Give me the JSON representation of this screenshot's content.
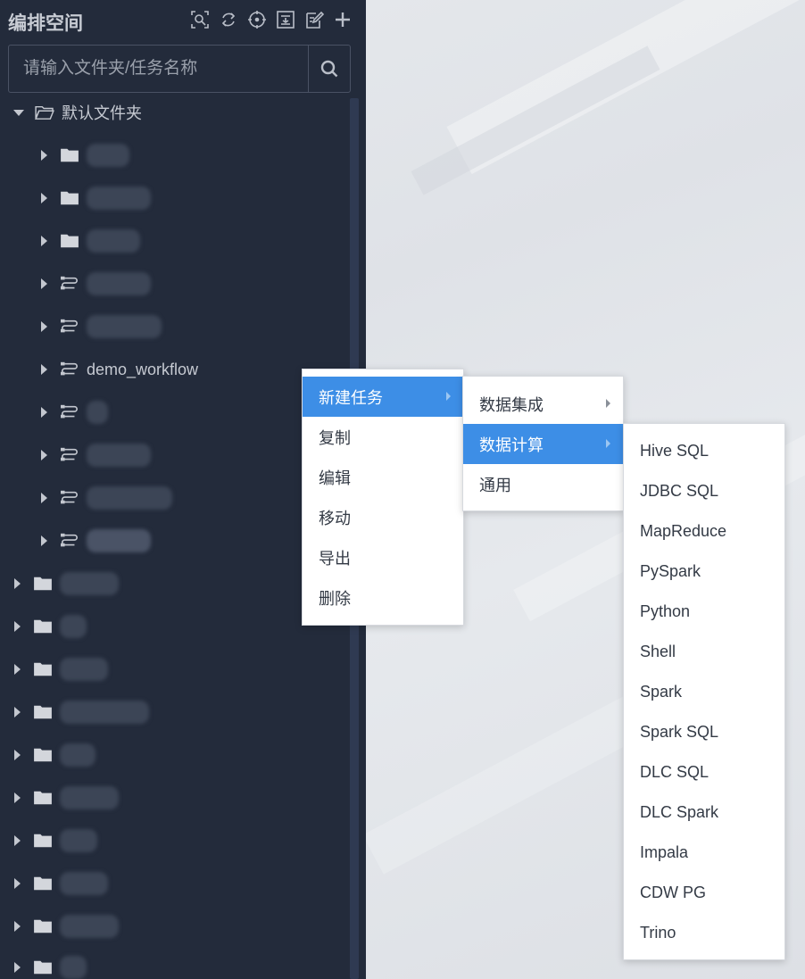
{
  "colors": {
    "sidebar_bg": "#232b3b",
    "accent": "#3d8ee6",
    "menu_bg": "#ffffff"
  },
  "sidebar": {
    "title": "编排空间",
    "toolbar_icons": [
      "locate-box-icon",
      "refresh-icon",
      "crosshair-icon",
      "import-icon",
      "edit-icon",
      "plus-icon"
    ],
    "search": {
      "placeholder": "请输入文件夹/任务名称",
      "value": ""
    },
    "tree": {
      "root_label": "默认文件夹",
      "children": [
        {
          "type": "folder",
          "label": ""
        },
        {
          "type": "folder",
          "label": ""
        },
        {
          "type": "folder",
          "label": ""
        },
        {
          "type": "workflow",
          "label": ""
        },
        {
          "type": "workflow",
          "label": ""
        },
        {
          "type": "workflow",
          "label": "demo_workflow"
        },
        {
          "type": "workflow",
          "label": ""
        },
        {
          "type": "workflow",
          "label": ""
        },
        {
          "type": "workflow",
          "label": ""
        },
        {
          "type": "workflow",
          "label": ""
        }
      ],
      "top_folders": [
        "",
        "",
        "",
        "",
        "",
        "",
        "",
        "",
        "",
        ""
      ]
    }
  },
  "context_menu": {
    "items": [
      "新建任务",
      "复制",
      "编辑",
      "移动",
      "导出",
      "删除"
    ],
    "active_index": 0
  },
  "submenu_new_task": {
    "items": [
      "数据集成",
      "数据计算",
      "通用"
    ],
    "active_index": 1
  },
  "submenu_compute": {
    "items": [
      "Hive SQL",
      "JDBC SQL",
      "MapReduce",
      "PySpark",
      "Python",
      "Shell",
      "Spark",
      "Spark SQL",
      "DLC SQL",
      "DLC Spark",
      "Impala",
      "CDW PG",
      "Trino"
    ]
  }
}
